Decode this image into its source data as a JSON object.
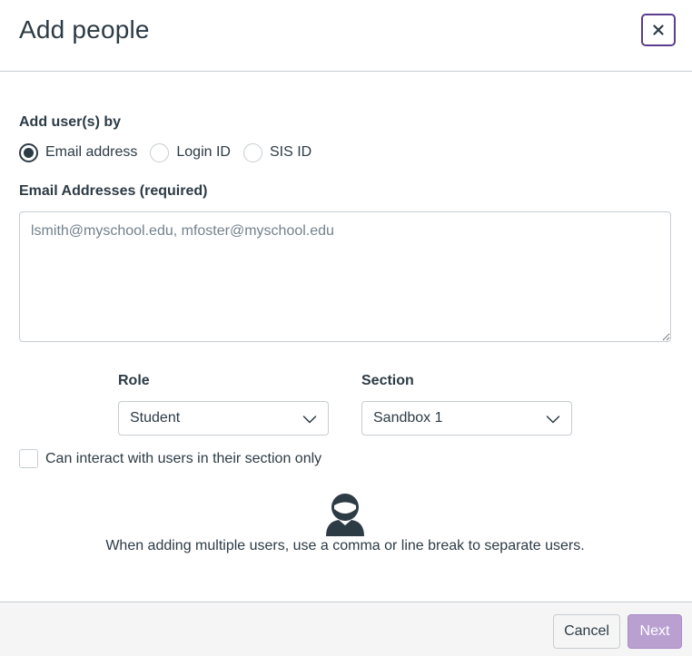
{
  "modal": {
    "title": "Add people",
    "close_icon": "close-icon"
  },
  "add_by": {
    "label": "Add user(s) by",
    "options": [
      {
        "label": "Email address",
        "selected": true
      },
      {
        "label": "Login ID",
        "selected": false
      },
      {
        "label": "SIS ID",
        "selected": false
      }
    ]
  },
  "emails": {
    "label": "Email Addresses (required)",
    "value": "",
    "placeholder": "lsmith@myschool.edu, mfoster@myschool.edu"
  },
  "role": {
    "label": "Role",
    "selected": "Student"
  },
  "section": {
    "label": "Section",
    "selected": "Sandbox 1"
  },
  "limit_checkbox": {
    "label": "Can interact with users in their section only",
    "checked": false
  },
  "hint": {
    "icon": "user-icon",
    "text": "When adding multiple users, use a comma or line break to separate users."
  },
  "footer": {
    "cancel_label": "Cancel",
    "next_label": "Next"
  },
  "colors": {
    "text": "#2d3b45",
    "border": "#c7cdd1",
    "accent": "#5c3d8f",
    "next_button": "#b9a0d1",
    "footer_bg": "#f5f5f5"
  }
}
